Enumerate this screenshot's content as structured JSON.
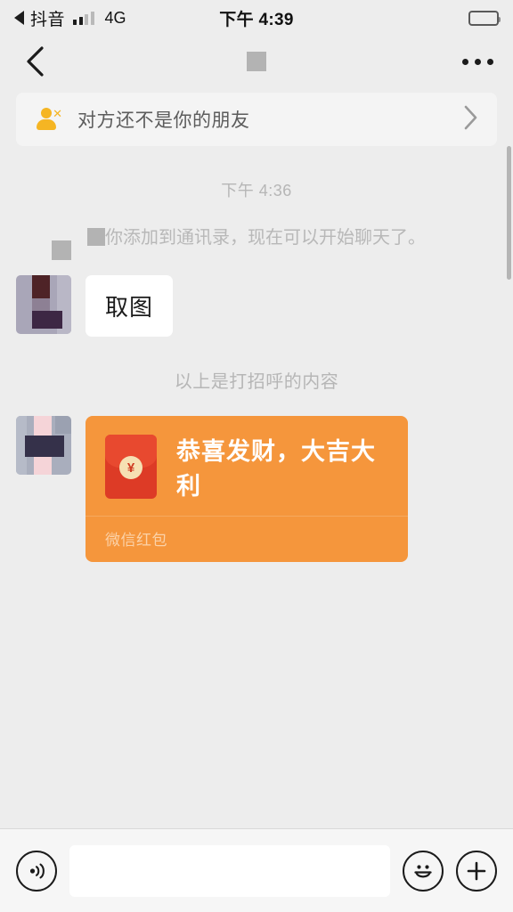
{
  "status_bar": {
    "back_app": "抖音",
    "back_arrow_icon": "triangle-left-icon",
    "signal_icon": "signal-bars-icon",
    "signal_bars_filled": 2,
    "signal_bars_total": 4,
    "network": "4G",
    "time": "下午 4:39",
    "battery_icon": "battery-full-icon"
  },
  "nav_bar": {
    "back_icon": "chevron-left-icon",
    "title_redacted": true,
    "more_icon": "ellipsis-icon"
  },
  "banner": {
    "icon": "person-x-icon",
    "text": "对方还不是你的朋友",
    "chevron_icon": "chevron-right-icon",
    "accent_color": "#f5b523"
  },
  "conversation": {
    "timestamp": "下午 4:36",
    "system_message": {
      "prefix_redacted": true,
      "text": "你添加到通讯录，现在可以开始聊天了。"
    },
    "messages": [
      {
        "type": "text",
        "avatar_name": "avatar-contact-1",
        "text": "取图"
      },
      {
        "type": "red-packet",
        "avatar_name": "avatar-contact-2",
        "icon": "red-envelope-icon",
        "currency_symbol": "¥",
        "title": "恭喜发财，大吉大利",
        "footer": "微信红包",
        "bubble_color": "#f5963c",
        "envelope_color": "#dd3b26"
      }
    ],
    "greeting_note": "以上是打招呼的内容"
  },
  "input_bar": {
    "voice_icon": "voice-wave-icon",
    "input_value": "",
    "input_placeholder": "",
    "emoji_icon": "smiley-icon",
    "plus_icon": "plus-icon"
  }
}
